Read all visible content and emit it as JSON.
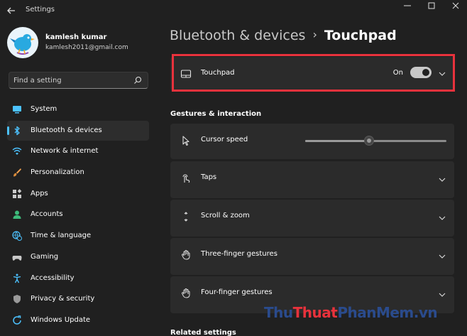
{
  "window": {
    "title": "Settings"
  },
  "profile": {
    "name": "kamlesh kumar",
    "email": "kamlesh2011@gmail.com"
  },
  "search": {
    "placeholder": "Find a setting"
  },
  "nav": {
    "items": [
      {
        "label": "System",
        "icon": "monitor-icon",
        "active": false
      },
      {
        "label": "Bluetooth & devices",
        "icon": "bluetooth-icon",
        "active": true
      },
      {
        "label": "Network & internet",
        "icon": "wifi-icon",
        "active": false
      },
      {
        "label": "Personalization",
        "icon": "brush-icon",
        "active": false
      },
      {
        "label": "Apps",
        "icon": "apps-icon",
        "active": false
      },
      {
        "label": "Accounts",
        "icon": "person-icon",
        "active": false
      },
      {
        "label": "Time & language",
        "icon": "globe-clock-icon",
        "active": false
      },
      {
        "label": "Gaming",
        "icon": "gamepad-icon",
        "active": false
      },
      {
        "label": "Accessibility",
        "icon": "accessibility-icon",
        "active": false
      },
      {
        "label": "Privacy & security",
        "icon": "shield-icon",
        "active": false
      },
      {
        "label": "Windows Update",
        "icon": "update-icon",
        "active": false
      }
    ]
  },
  "breadcrumb": {
    "parent": "Bluetooth & devices",
    "separator": "›",
    "current": "Touchpad"
  },
  "touchpad": {
    "label": "Touchpad",
    "state_text": "On",
    "enabled": true
  },
  "gestures": {
    "heading": "Gestures & interaction",
    "cursor_speed": {
      "label": "Cursor speed",
      "value_fraction": 0.45
    },
    "taps": {
      "label": "Taps"
    },
    "scroll_zoom": {
      "label": "Scroll & zoom"
    },
    "three_finger": {
      "label": "Three-finger gestures"
    },
    "four_finger": {
      "label": "Four-finger gestures"
    }
  },
  "related": {
    "heading": "Related settings"
  },
  "watermark": {
    "part1": "Thu",
    "part2": "Thuat",
    "part3": "PhanMem.vn"
  },
  "colors": {
    "accent": "#4cc2ff",
    "highlight": "#e8323c",
    "background": "#202020",
    "card": "#2b2b2b"
  }
}
